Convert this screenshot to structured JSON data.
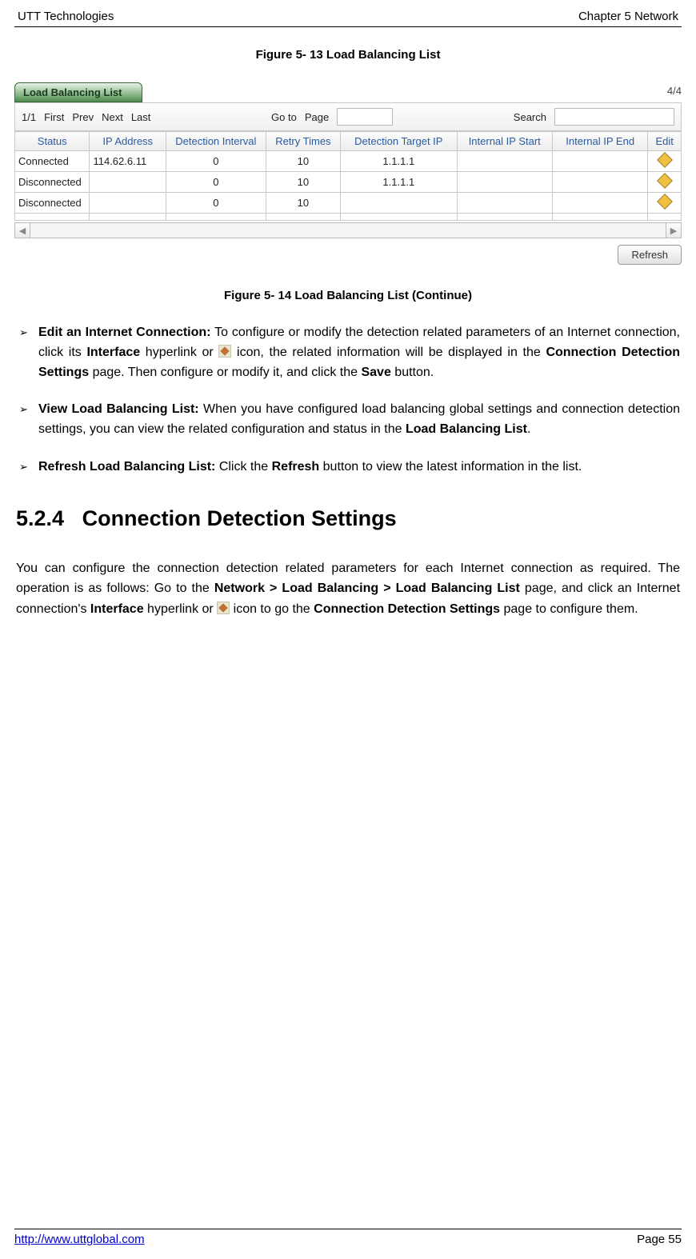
{
  "header": {
    "left": "UTT Technologies",
    "right": "Chapter 5 Network"
  },
  "figure13": "Figure 5- 13 Load Balancing List",
  "figure14": "Figure 5- 14 Load Balancing List (Continue)",
  "widget": {
    "tab": "Load Balancing List",
    "count": "4/4",
    "toolbar": {
      "pager": "1/1",
      "first": "First",
      "prev": "Prev",
      "next": "Next",
      "last": "Last",
      "goto": "Go to",
      "page": "Page",
      "page_value": "",
      "search": "Search",
      "search_value": ""
    },
    "headers": [
      "Status",
      "IP Address",
      "Detection Interval",
      "Retry Times",
      "Detection Target IP",
      "Internal IP Start",
      "Internal IP End",
      "Edit"
    ],
    "rows": [
      {
        "status": "Connected",
        "ip": "114.62.6.11",
        "interval": "0",
        "retry": "10",
        "target": "1.1.1.1",
        "istart": "",
        "iend": "",
        "edit": true
      },
      {
        "status": "Disconnected",
        "ip": "",
        "interval": "0",
        "retry": "10",
        "target": "1.1.1.1",
        "istart": "",
        "iend": "",
        "edit": true
      },
      {
        "status": "Disconnected",
        "ip": "",
        "interval": "0",
        "retry": "10",
        "target": "",
        "istart": "",
        "iend": "",
        "edit": true
      },
      {
        "status": "",
        "ip": "",
        "interval": "",
        "retry": "",
        "target": "",
        "istart": "",
        "iend": "",
        "edit": false
      }
    ],
    "refresh": "Refresh"
  },
  "bullets": {
    "b1a": "Edit an Internet Connection:",
    "b1b": " To configure or modify the detection related parameters of an Internet connection, click its ",
    "b1c": "Interface",
    "b1d": " hyperlink or ",
    "b1e": " icon, the related information will be displayed in the ",
    "b1f": "Connection Detection Settings",
    "b1g": " page. Then configure or modify it, and click the ",
    "b1h": "Save",
    "b1i": " button.",
    "b2a": "View Load Balancing List:",
    "b2b": " When you have configured load balancing global settings and connection detection settings, you can view the related configuration and status in the ",
    "b2c": "Load Balancing List",
    "b2d": ".",
    "b3a": "Refresh Load Balancing List:",
    "b3b": " Click the ",
    "b3c": "Refresh",
    "b3d": " button to view the latest information in the list."
  },
  "section": {
    "number": "5.2.4",
    "title": "Connection Detection Settings"
  },
  "para": {
    "p1": "You can configure the connection detection related parameters for each Internet connection as required. The operation is as follows: Go to the ",
    "p2": "Network > Load Balancing > Load Balancing List",
    "p3": " page, and click an Internet connection's ",
    "p4": "Interface",
    "p5": " hyperlink or ",
    "p6": " icon to go the ",
    "p7": "Connection Detection Settings",
    "p8": " page to configure them."
  },
  "footer": {
    "url": "http://www.uttglobal.com",
    "page": "Page 55"
  }
}
